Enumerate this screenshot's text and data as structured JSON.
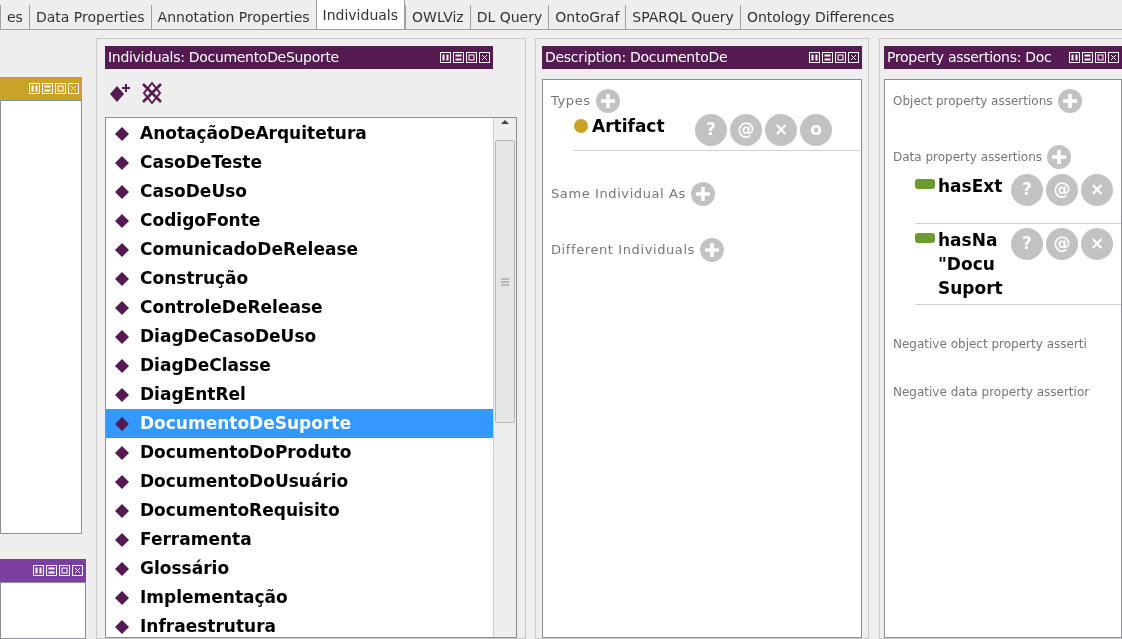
{
  "tabs": [
    {
      "label": "es",
      "selected": false
    },
    {
      "label": "Data Properties",
      "selected": false
    },
    {
      "label": "Annotation Properties",
      "selected": false
    },
    {
      "label": "Individuals",
      "selected": true
    },
    {
      "label": "OWLViz",
      "selected": false
    },
    {
      "label": "DL Query",
      "selected": false
    },
    {
      "label": "OntoGraf",
      "selected": false
    },
    {
      "label": "SPARQL Query",
      "selected": false
    },
    {
      "label": "Ontology Differences",
      "selected": false
    }
  ],
  "side_panels": [
    {
      "color": "#c9a227"
    },
    {
      "color": "#7b3fa0"
    }
  ],
  "individuals": {
    "title": "Individuals: DocumentoDeSuporte",
    "items": [
      {
        "label": "AnotaçãoDeArquitetura",
        "selected": false
      },
      {
        "label": "CasoDeTeste",
        "selected": false
      },
      {
        "label": "CasoDeUso",
        "selected": false
      },
      {
        "label": "CodigoFonte",
        "selected": false
      },
      {
        "label": "ComunicadoDeRelease",
        "selected": false
      },
      {
        "label": "Construção",
        "selected": false
      },
      {
        "label": "ControleDeRelease",
        "selected": false
      },
      {
        "label": "DiagDeCasoDeUso",
        "selected": false
      },
      {
        "label": "DiagDeClasse",
        "selected": false
      },
      {
        "label": "DiagEntRel",
        "selected": false
      },
      {
        "label": "DocumentoDeSuporte",
        "selected": true
      },
      {
        "label": "DocumentoDoProduto",
        "selected": false
      },
      {
        "label": "DocumentoDoUsuário",
        "selected": false
      },
      {
        "label": "DocumentoRequisito",
        "selected": false
      },
      {
        "label": "Ferramenta",
        "selected": false
      },
      {
        "label": "Glossário",
        "selected": false
      },
      {
        "label": "Implementação",
        "selected": false
      },
      {
        "label": "Infraestrutura",
        "selected": false
      }
    ]
  },
  "description": {
    "title": "Description: DocumentoDe",
    "sections": [
      {
        "label": "Types",
        "items": [
          {
            "kind": "class",
            "lines": [
              "Artifact"
            ],
            "buttons": [
              "?",
              "@",
              "×",
              "o"
            ]
          }
        ]
      },
      {
        "label": "Same Individual As"
      },
      {
        "label": "Different Individuals"
      }
    ]
  },
  "property_assertions": {
    "title": "Property assertions: Doc",
    "sections": [
      {
        "label": "Object property assertions"
      },
      {
        "label": "Data property assertions",
        "items": [
          {
            "kind": "data",
            "lines": [
              "hasExt"
            ],
            "buttons": [
              "?",
              "@",
              "×"
            ]
          },
          {
            "kind": "data",
            "lines": [
              "hasNa",
              "\"Docu",
              "Suport"
            ],
            "buttons": [
              "?",
              "@",
              "×"
            ]
          }
        ]
      },
      {
        "label": "Negative object property asserti"
      },
      {
        "label": "Negative data property assertior"
      }
    ]
  }
}
